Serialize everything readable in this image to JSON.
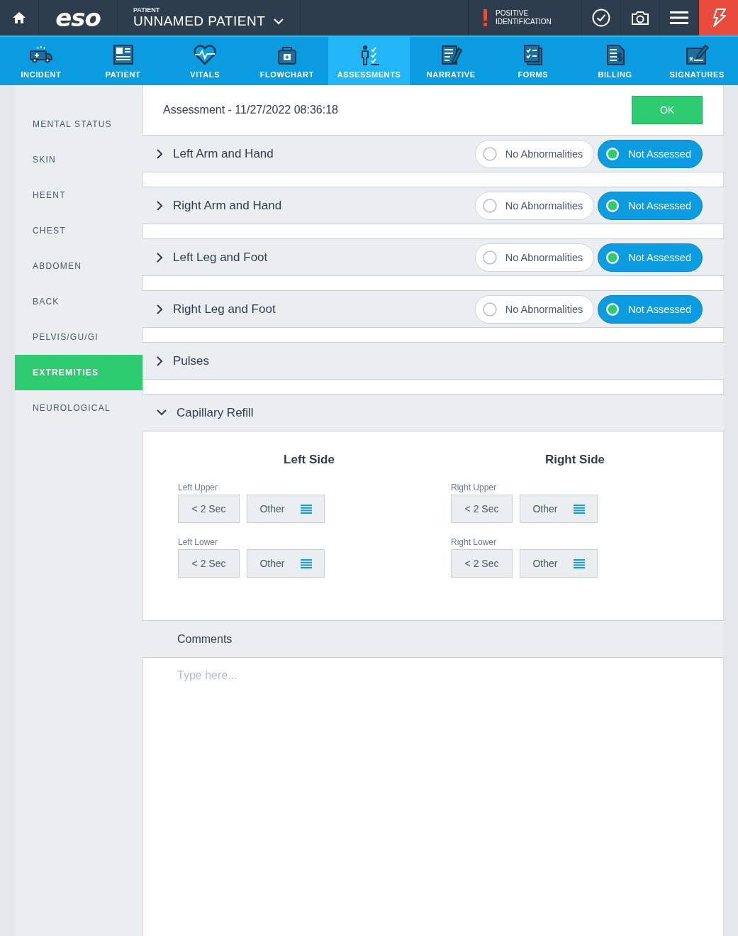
{
  "topbar": {
    "logo": "eso",
    "patient_label": "PATIENT",
    "patient_name": "UNNAMED PATIENT",
    "alert": "POSITIVE IDENTIFICATION"
  },
  "nav_tabs": [
    {
      "label": "INCIDENT",
      "selected": false
    },
    {
      "label": "PATIENT",
      "selected": false
    },
    {
      "label": "VITALS",
      "selected": false
    },
    {
      "label": "FLOWCHART",
      "selected": false
    },
    {
      "label": "ASSESSMENTS",
      "selected": true
    },
    {
      "label": "NARRATIVE",
      "selected": false
    },
    {
      "label": "FORMS",
      "selected": false
    },
    {
      "label": "BILLING",
      "selected": false
    },
    {
      "label": "SIGNATURES",
      "selected": false
    }
  ],
  "sidebar": {
    "items": [
      {
        "label": "MENTAL STATUS",
        "selected": false
      },
      {
        "label": "SKIN",
        "selected": false
      },
      {
        "label": "HEENT",
        "selected": false
      },
      {
        "label": "CHEST",
        "selected": false
      },
      {
        "label": "ABDOMEN",
        "selected": false
      },
      {
        "label": "BACK",
        "selected": false
      },
      {
        "label": "PELVIS/GU/GI",
        "selected": false
      },
      {
        "label": "EXTREMITIES",
        "selected": true
      },
      {
        "label": "NEUROLOGICAL",
        "selected": false
      }
    ]
  },
  "assessment": {
    "title": "Assessment - 11/27/2022 08:36:18",
    "ok_button": "OK"
  },
  "sections": [
    {
      "title": "Left Arm and Hand",
      "expanded": false,
      "options": [
        {
          "label": "No Abnormalities",
          "selected": false
        },
        {
          "label": "Not Assessed",
          "selected": true
        }
      ]
    },
    {
      "title": "Right Arm and Hand",
      "expanded": false,
      "options": [
        {
          "label": "No Abnormalities",
          "selected": false
        },
        {
          "label": "Not Assessed",
          "selected": true
        }
      ]
    },
    {
      "title": "Left Leg and Foot",
      "expanded": false,
      "options": [
        {
          "label": "No Abnormalities",
          "selected": false
        },
        {
          "label": "Not Assessed",
          "selected": true
        }
      ]
    },
    {
      "title": "Right Leg and Foot",
      "expanded": false,
      "options": [
        {
          "label": "No Abnormalities",
          "selected": false
        },
        {
          "label": "Not Assessed",
          "selected": true
        }
      ]
    },
    {
      "title": "Pulses",
      "expanded": false
    },
    {
      "title": "Capillary Refill",
      "expanded": true,
      "sides": [
        {
          "heading": "Left Side",
          "fields": [
            {
              "label": "Left Upper",
              "buttons": [
                "< 2 Sec",
                "Other"
              ]
            },
            {
              "label": "Left Lower",
              "buttons": [
                "< 2 Sec",
                "Other"
              ]
            }
          ]
        },
        {
          "heading": "Right Side",
          "fields": [
            {
              "label": "Right Upper",
              "buttons": [
                "< 2 Sec",
                "Other"
              ]
            },
            {
              "label": "Right Lower",
              "buttons": [
                "< 2 Sec",
                "Other"
              ]
            }
          ]
        }
      ]
    }
  ],
  "comments": {
    "title": "Comments",
    "placeholder": "Type here..."
  }
}
